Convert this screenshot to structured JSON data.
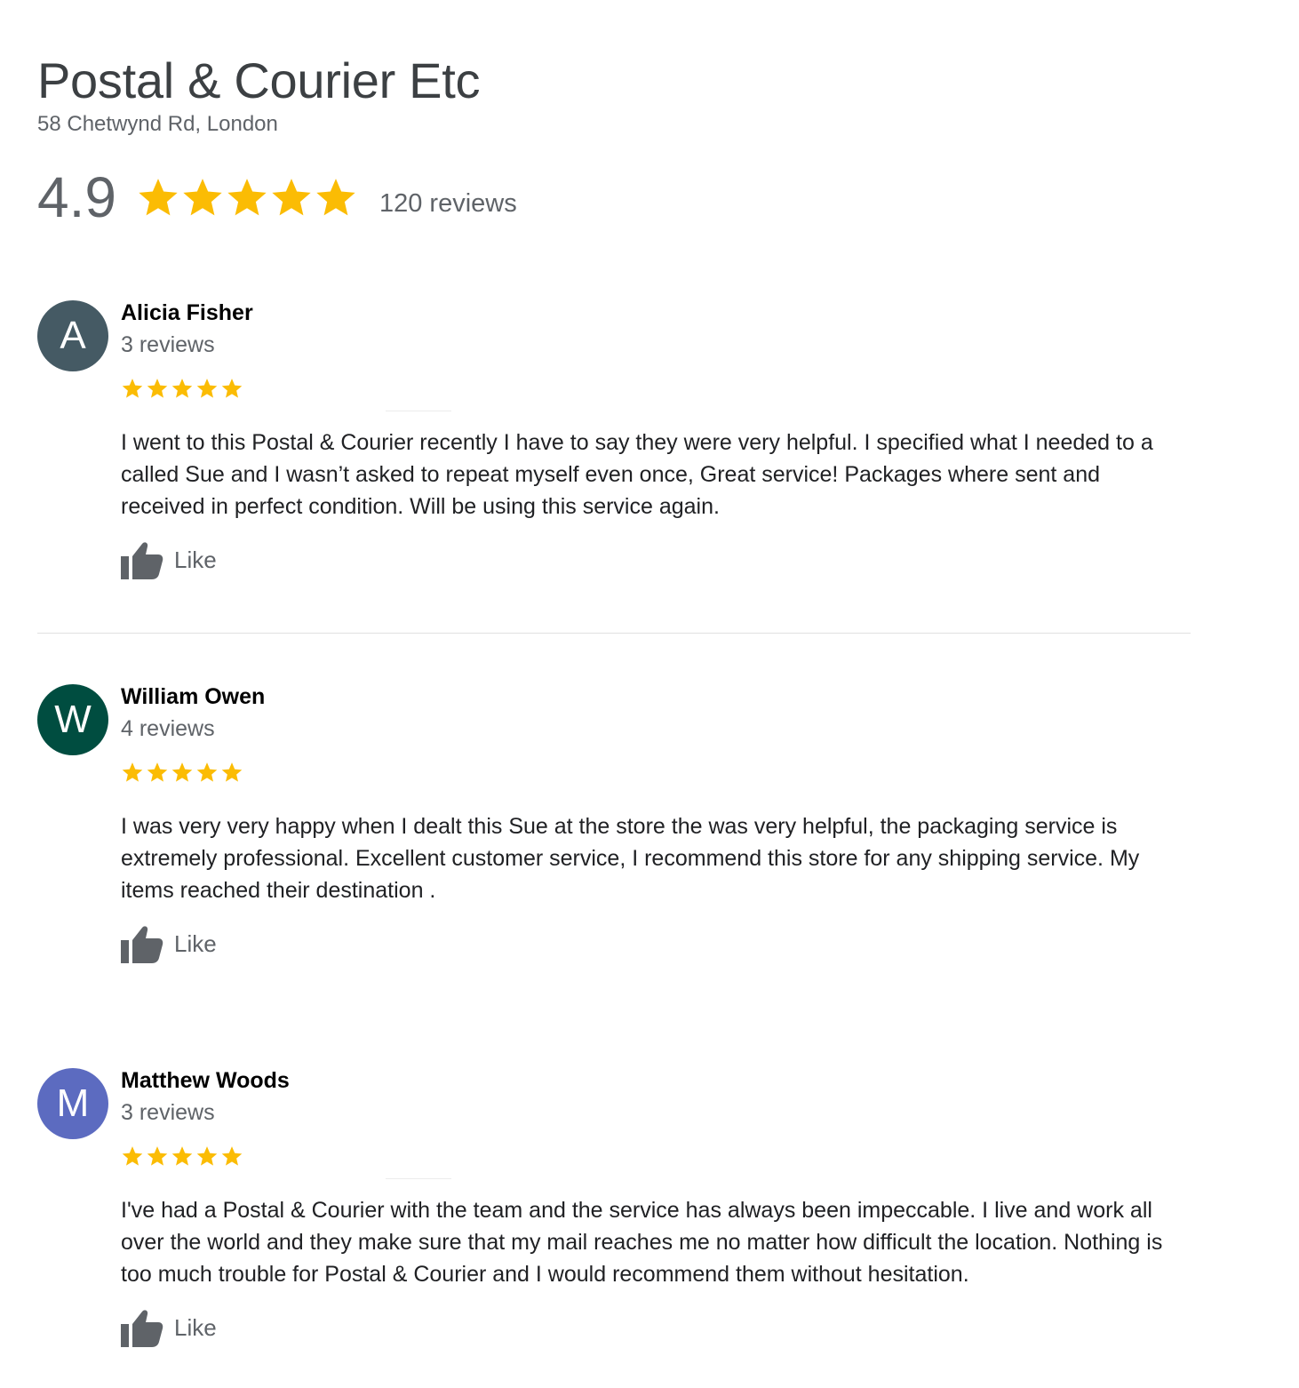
{
  "business": {
    "name": "Postal & Courier Etc",
    "address": "58 Chetwynd Rd, London",
    "rating": "4.9",
    "rating_stars": 4.9,
    "review_count_label": "120 reviews"
  },
  "colors": {
    "star": "#fbbc04",
    "avatar_a": "#455a64",
    "avatar_w": "#004d40",
    "avatar_m": "#5c6bc0"
  },
  "reviews": [
    {
      "initial": "A",
      "name": "Alicia Fisher",
      "count_label": "3 reviews",
      "stars": 5,
      "text": "I went to this Postal & Courier recently I have to say they were very helpful. I specified what I needed to a called Sue and I wasn’t asked to repeat myself even once, Great service! Packages where sent and received in perfect condition. Will be using this service again.",
      "like_label": "Like"
    },
    {
      "initial": "W",
      "name": "William Owen",
      "count_label": "4 reviews",
      "stars": 5,
      "text": "I was very very happy when I dealt this Sue at the store the was very helpful, the packaging service is extremely professional. Excellent customer service, I recommend this store for any shipping service. My items reached their destination .",
      "like_label": "Like"
    },
    {
      "initial": "M",
      "name": "Matthew Woods",
      "count_label": "3 reviews",
      "stars": 5,
      "text": "I've had a Postal & Courier with the team and the service has always been impeccable. I live and work all over the world and they make sure that my mail reaches me no matter how difficult the location. Nothing is too much trouble for Postal & Courier and I would recommend them without hesitation.",
      "like_label": "Like"
    }
  ]
}
